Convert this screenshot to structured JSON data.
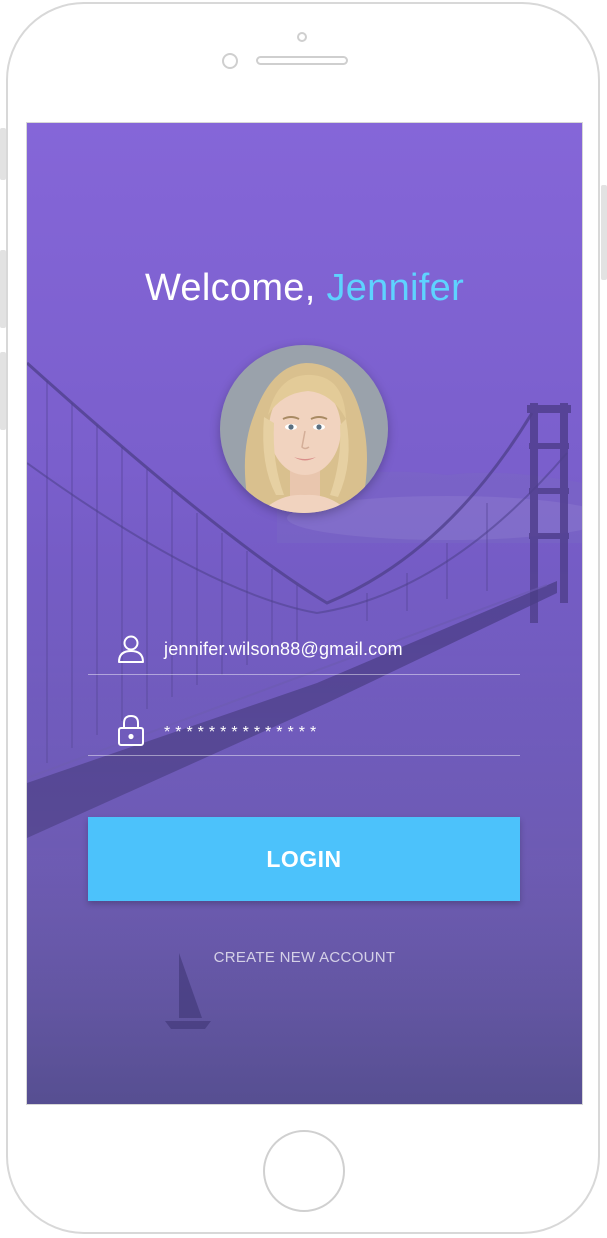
{
  "welcome": {
    "greeting": "Welcome,",
    "name": "Jennifer"
  },
  "avatar": {
    "alt": "Jennifer profile photo"
  },
  "email_field": {
    "icon": "user-icon",
    "value": "jennifer.wilson88@gmail.com"
  },
  "password_field": {
    "icon": "lock-icon",
    "value": "**************"
  },
  "login_button": {
    "label": "LOGIN"
  },
  "create_account": {
    "label": "CREATE NEW ACCOUNT"
  },
  "colors": {
    "accent": "#4cc2fb",
    "name_highlight": "#5ed3ff",
    "background_top": "#8566d8",
    "background_bottom": "#5c4d9c"
  }
}
